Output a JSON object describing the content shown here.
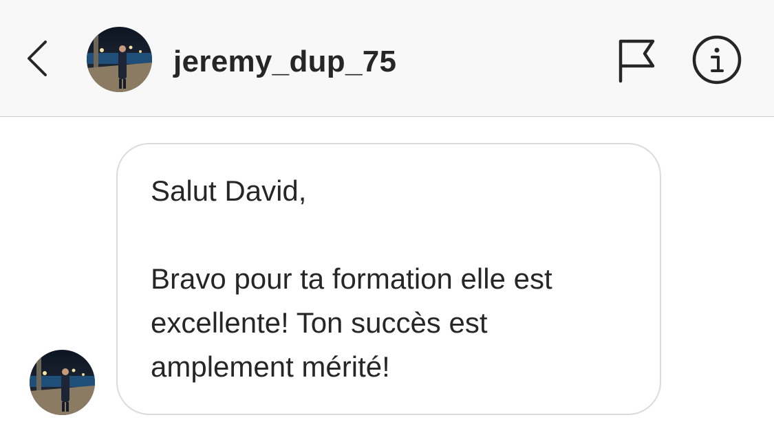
{
  "header": {
    "username": "jeremy_dup_75",
    "back_icon": "chevron-left-icon",
    "flag_icon": "flag-icon",
    "info_icon": "info-icon"
  },
  "conversation": {
    "messages": [
      {
        "sender": "jeremy_dup_75",
        "greeting": "Salut David,",
        "body": "Bravo pour ta formation elle est excellente! Ton succès est amplement mérité!"
      }
    ]
  },
  "colors": {
    "header_bg": "#f8f8f8",
    "text": "#262626",
    "bubble_border": "#dbdbdb",
    "divider": "#cfcfcf"
  }
}
